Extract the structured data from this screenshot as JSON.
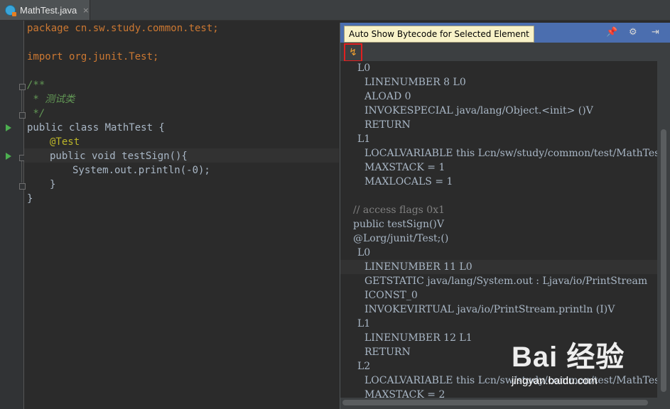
{
  "tab": {
    "title": "MathTest.java",
    "close": "×"
  },
  "editor_lines": [
    "package cn.sw.study.common.test;",
    "import org.junit.Test;",
    "/**",
    " * 测试类",
    " */",
    "public class MathTest {",
    "@Test",
    "public void testSign(){",
    "System.out.println(-0);",
    "}",
    "}"
  ],
  "panel": {
    "tooltip": "Auto Show Bytecode for Selected Element",
    "auto_icon": "↯",
    "pin_icon": "pin-icon",
    "gear_icon": "gear-icon",
    "hide_icon": "hide-icon"
  },
  "bytecode": [
    "L0",
    "LINENUMBER 8 L0",
    "ALOAD 0",
    "INVOKESPECIAL java/lang/Object.<init> ()V",
    "RETURN",
    "L1",
    "LOCALVARIABLE this Lcn/sw/study/common/test/MathTest",
    "MAXSTACK = 1",
    "MAXLOCALS = 1",
    "// access flags 0x1",
    "public testSign()V",
    "@Lorg/junit/Test;()",
    "L0",
    "LINENUMBER 11 L0",
    "GETSTATIC java/lang/System.out : Ljava/io/PrintStream",
    "ICONST_0",
    "INVOKEVIRTUAL java/io/PrintStream.println (I)V",
    "L1",
    "LINENUMBER 12 L1",
    "RETURN",
    "L2",
    "LOCALVARIABLE this Lcn/sw/study/common/test/MathTest",
    "MAXSTACK = 2"
  ],
  "watermark": {
    "logo": "Bai 经验",
    "url": "jingyan.baidu.com"
  }
}
